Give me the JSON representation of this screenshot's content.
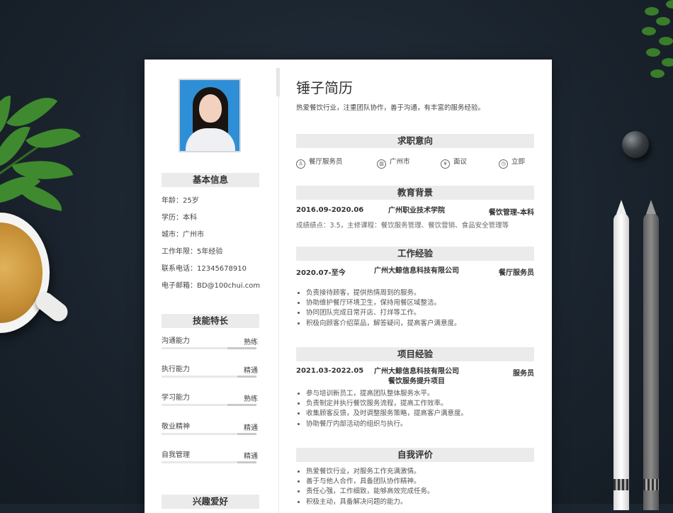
{
  "resume": {
    "title": "锤子简历",
    "intro": "热爱餐饮行业，注重团队协作，善于沟通，有丰富的服务经验。",
    "basic": {
      "heading": "基本信息",
      "items": [
        "年龄：25岁",
        "学历：本科",
        "城市：广州市",
        "工作年限：5年经验",
        "联系电话：12345678910",
        "电子邮箱：BD@100chui.com"
      ]
    },
    "skills": {
      "heading": "技能特长",
      "items": [
        {
          "name": "沟通能力",
          "level": "熟练",
          "percent": 80
        },
        {
          "name": "执行能力",
          "level": "精通",
          "percent": 90
        },
        {
          "name": "学习能力",
          "level": "熟练",
          "percent": 80
        },
        {
          "name": "敬业精神",
          "level": "精通",
          "percent": 90
        },
        {
          "name": "自我管理",
          "level": "精通",
          "percent": 90
        }
      ]
    },
    "hobbies": {
      "heading": "兴趣爱好"
    },
    "intent": {
      "heading": "求职意向",
      "items": [
        {
          "icon": "tie-icon",
          "glyph": "♙",
          "text": "餐厅服务员"
        },
        {
          "icon": "building-icon",
          "glyph": "▥",
          "text": "广州市"
        },
        {
          "icon": "yuan-icon",
          "glyph": "¥",
          "text": "面议"
        },
        {
          "icon": "clock-icon",
          "glyph": "◷",
          "text": "立即"
        }
      ]
    },
    "education": {
      "heading": "教育背景",
      "date": "2016.09-2020.06",
      "school": "广州职业技术学院",
      "major": "餐饮管理-本科",
      "note": "成绩绩点：3.5，主修课程：餐饮服务管理、餐饮营销、食品安全管理等"
    },
    "work": {
      "heading": "工作经验",
      "date": "2020.07-至今",
      "company": "广州大鲸信息科技有限公司",
      "role": "餐厅服务员",
      "bullets": [
        "负责接待顾客，提供热情周到的服务。",
        "协助维护餐厅环境卫生，保持用餐区域整洁。",
        "协同团队完成日常开店、打烊等工作。",
        "积极向顾客介绍菜品，解答疑问，提高客户满意度。"
      ]
    },
    "project": {
      "heading": "项目经验",
      "date": "2021.03-2022.05",
      "company": "广州大鲸信息科技有限公司餐饮服务提升项目",
      "role": "服务员",
      "bullets": [
        "参与培训新员工，提高团队整体服务水平。",
        "负责制定并执行餐饮服务流程，提高工作效率。",
        "收集顾客反馈，及时调整服务策略，提高客户满意度。",
        "协助餐厅内部活动的组织与执行。"
      ]
    },
    "self": {
      "heading": "自我评价",
      "bullets": [
        "热爱餐饮行业，对服务工作充满激情。",
        "善于与他人合作，具备团队协作精神。",
        "责任心强，工作细致，能够高效完成任务。",
        "积极主动，具备解决问题的能力。"
      ]
    }
  }
}
